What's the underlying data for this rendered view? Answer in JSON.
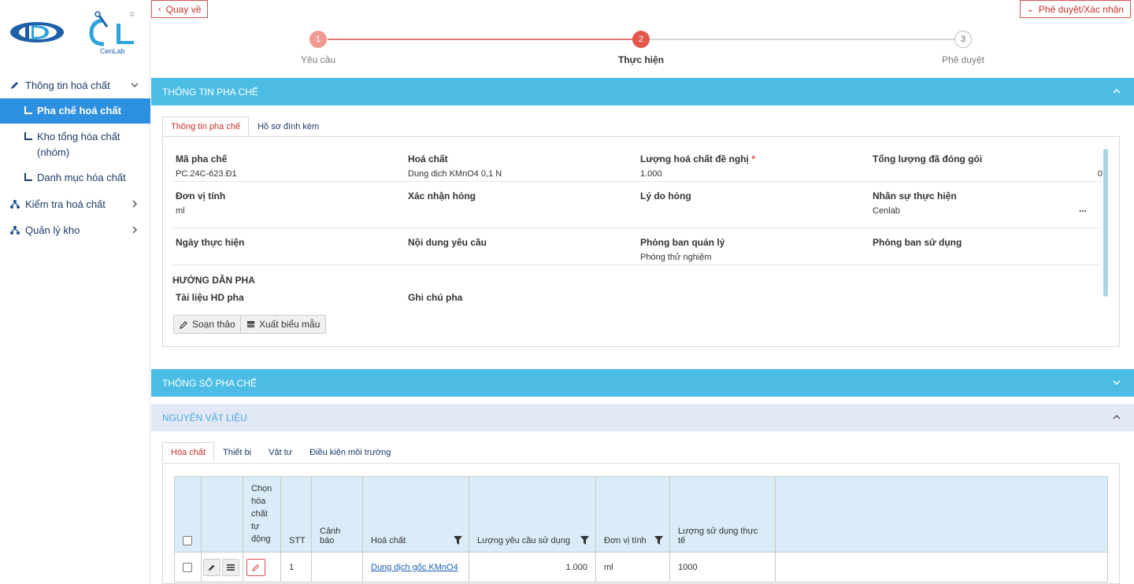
{
  "brand": {
    "logo_text": "CenLab",
    "trademark": "©"
  },
  "sidebar": {
    "items": [
      {
        "label": "Thông tin hoá chất"
      },
      {
        "label": "Pha chế hoá chất"
      },
      {
        "label": "Kho tổng hóa chất (nhóm)"
      },
      {
        "label": "Danh mục hóa chất"
      },
      {
        "label": "Kiểm tra hoá chất"
      },
      {
        "label": "Quản lý kho"
      }
    ]
  },
  "toolbar": {
    "back_label": "Quay về",
    "approve_label": "Phê duyệt/Xác nhận"
  },
  "stepper": {
    "steps": [
      {
        "number": "1",
        "label": "Yêu cầu"
      },
      {
        "number": "2",
        "label": "Thực hiện"
      },
      {
        "number": "3",
        "label": "Phê duyệt"
      }
    ]
  },
  "panel_info": {
    "title": "THÔNG TIN PHA CHẾ",
    "tabs": [
      "Thông tin pha chế",
      "Hồ sơ đính kèm"
    ],
    "fields": {
      "ma_pha_che": {
        "label": "Mã pha chế",
        "value": "PC.24C-623.Đ1"
      },
      "hoa_chat": {
        "label": "Hoá chất",
        "value": "Dung dịch KMnO4 0,1 N"
      },
      "luong_de_nghi": {
        "label": "Lượng hoá chất đề nghị",
        "required": "*",
        "value": "1.000"
      },
      "tong_luong": {
        "label": "Tổng lượng đã đóng gói",
        "value": "0"
      },
      "don_vi": {
        "label": "Đơn vị tính",
        "value": "ml"
      },
      "xac_nhan_hong": {
        "label": "Xác nhận hỏng",
        "value": ""
      },
      "ly_do_hong": {
        "label": "Lý do hỏng",
        "value": ""
      },
      "nhan_su": {
        "label": "Nhân sự thực hiện",
        "value": "Cenlab",
        "more": "..."
      },
      "ngay_thuc_hien": {
        "label": "Ngày thực hiện",
        "value": ""
      },
      "noi_dung": {
        "label": "Nội dung yêu cầu",
        "value": ""
      },
      "phong_quan_ly": {
        "label": "Phòng ban quản lý",
        "value": "Phòng thử nghiệm"
      },
      "phong_su_dung": {
        "label": "Phòng ban sử dụng",
        "value": ""
      }
    },
    "guide_title": "HƯỚNG DẪN PHA",
    "guide_doc_label": "Tài liệu HD pha",
    "guide_note_label": "Ghi chú pha",
    "compose_label": "Soạn thảo",
    "export_label": "Xuất biểu mẫu"
  },
  "panel_params": {
    "title": "THÔNG SỐ PHA CHẾ"
  },
  "panel_materials": {
    "title": "NGUYÊN VẬT LIỆU",
    "tabs": [
      "Hóa chất",
      "Thiết bị",
      "Vật tư",
      "Điều kiện môi trường"
    ],
    "table": {
      "headers": {
        "auto": "Chọn hóa chất tự động",
        "stt": "STT",
        "warning": "Cảnh báo",
        "chemical": "Hoá chất",
        "requested": "Lượng yêu cầu sử dụng",
        "unit": "Đơn vị tính",
        "actual": "Lượng sử dụng thực tế"
      },
      "rows": [
        {
          "stt": "1",
          "warning": "",
          "chemical": "Dung dịch gốc KMnO4",
          "requested": "1.000",
          "unit": "ml",
          "actual": "1000"
        }
      ]
    }
  },
  "colors": {
    "panel_blue": "#4bbde4",
    "accent_red": "#d9534f",
    "sidebar_active": "#2d8fe0"
  }
}
